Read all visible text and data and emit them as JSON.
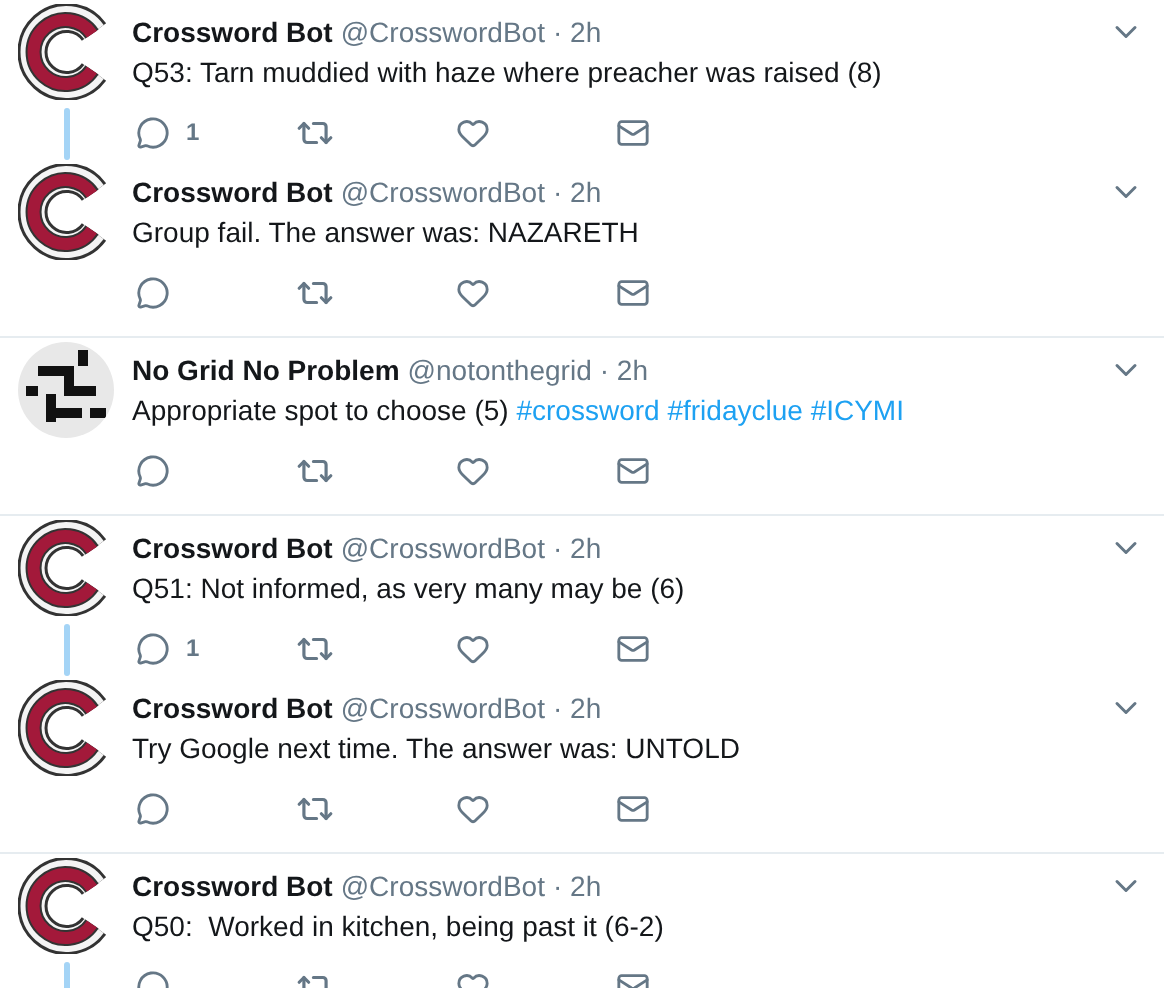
{
  "tweets": [
    {
      "kind": "c-logo",
      "name": "Crossword Bot",
      "handle": "@CrosswordBot",
      "time": "· 2h",
      "text": "Q53: Tarn muddied with haze where preacher was raised (8)",
      "reply_count": "1",
      "threaded": true
    },
    {
      "kind": "c-logo",
      "name": "Crossword Bot",
      "handle": "@CrosswordBot",
      "time": "· 2h",
      "text": "Group fail. The answer was: NAZARETH",
      "threaded": false
    },
    {
      "kind": "grid",
      "name": "No Grid No Problem",
      "handle": "@notonthegrid",
      "time": "· 2h",
      "text": "Appropriate spot to choose (5)",
      "hashtags": [
        "#crossword",
        "#fridayclue",
        "#ICYMI"
      ],
      "threaded": false
    },
    {
      "kind": "c-logo",
      "name": "Crossword Bot",
      "handle": "@CrosswordBot",
      "time": "· 2h",
      "text": "Q51: Not informed, as very many may be (6)",
      "reply_count": "1",
      "threaded": true
    },
    {
      "kind": "c-logo",
      "name": "Crossword Bot",
      "handle": "@CrosswordBot",
      "time": "· 2h",
      "text": "Try Google next time. The answer was: UNTOLD",
      "threaded": false
    },
    {
      "kind": "c-logo",
      "name": "Crossword Bot",
      "handle": "@CrosswordBot",
      "time": "· 2h",
      "text": "Q50:  Worked in kitchen, being past it (6-2)",
      "threaded": true
    }
  ]
}
